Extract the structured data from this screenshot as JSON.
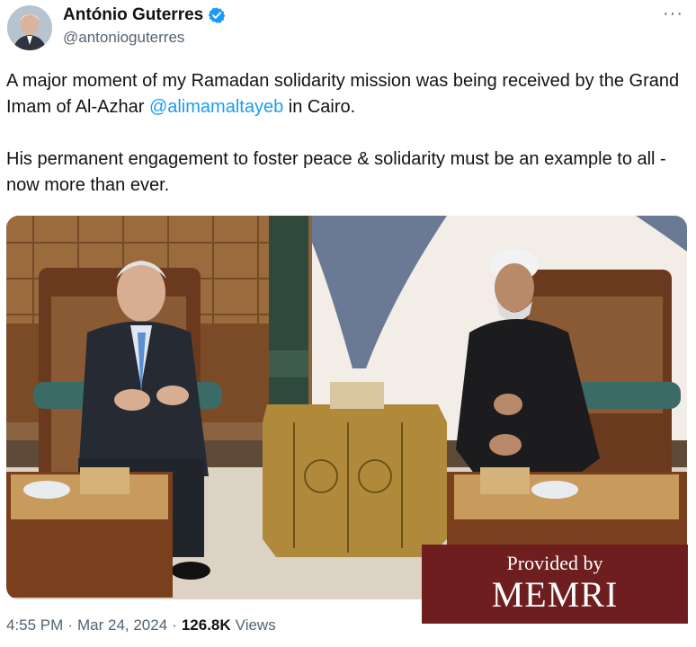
{
  "author": {
    "display_name": "António Guterres",
    "handle": "@antonioguterres",
    "verified_icon": "verified-badge-icon",
    "avatar_icon": "profile-avatar"
  },
  "more_label": "···",
  "tweet": {
    "line1_before": "A major moment of my Ramadan solidarity mission was being received by the Grand Imam of Al-Azhar ",
    "mention": "@alimamaltayeb",
    "line1_after": " in Cairo.",
    "paragraph2": "His permanent engagement to foster peace & solidarity must be an example to all - now more than ever."
  },
  "watermark": {
    "line1": "Provided by",
    "line2": "MEMRI"
  },
  "meta": {
    "time": "4:55 PM",
    "separator": "·",
    "date": "Mar 24, 2024",
    "views_count": "126.8K",
    "views_label": "Views"
  },
  "colors": {
    "accent": "#1d9bf0",
    "secondary_text": "#536471",
    "watermark_bg": "#6e1e1e"
  }
}
